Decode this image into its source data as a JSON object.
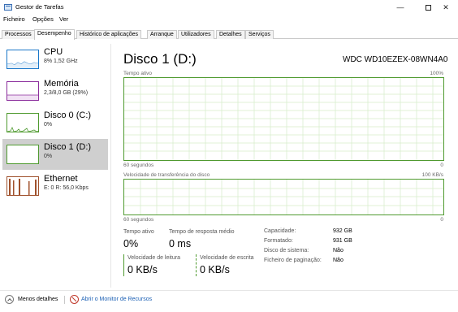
{
  "window": {
    "title": "Gestor de Tarefas",
    "controls": {
      "minimize": "—",
      "close": "✕"
    }
  },
  "menu": [
    "Ficheiro",
    "Opções",
    "Ver"
  ],
  "tabs": [
    "Processos",
    "Desempenho",
    "Histórico de aplicações",
    "Arranque",
    "Utilizadores",
    "Detalhes",
    "Serviços"
  ],
  "active_tab": "Desempenho",
  "resources": [
    {
      "name": "CPU",
      "sub": "8% 1,52 GHz",
      "color": "#1a77c9"
    },
    {
      "name": "Memória",
      "sub": "2,3/8,0 GB (29%)",
      "color": "#8b2d9c"
    },
    {
      "name": "Disco 0 (C:)",
      "sub": "0%",
      "color": "#4f9a2f"
    },
    {
      "name": "Disco 1 (D:)",
      "sub": "0%",
      "color": "#4f9a2f",
      "selected": true
    },
    {
      "name": "Ethernet",
      "sub": "E: 0 R: 56,0 Kbps",
      "color": "#a0522d"
    }
  ],
  "main": {
    "title": "Disco 1 (D:)",
    "model": "WDC WD10EZEX-08WN4A0",
    "graph1": {
      "label": "Tempo ativo",
      "max": "100%",
      "time": "60 segundos",
      "min": "0"
    },
    "graph2": {
      "label": "Velocidade de transferência do disco",
      "max": "100 KB/s",
      "time": "60 segundos",
      "min": "0"
    },
    "stats": {
      "active_time_label": "Tempo ativo",
      "active_time_value": "0%",
      "response_label": "Tempo de resposta médio",
      "response_value": "0 ms",
      "read_label": "Velocidade de leitura",
      "read_value": "0 KB/s",
      "write_label": "Velocidade de escrita",
      "write_value": "0 KB/s"
    },
    "properties": [
      {
        "key": "Capacidade:",
        "value": "932 GB"
      },
      {
        "key": "Formatado:",
        "value": "931 GB"
      },
      {
        "key": "Disco de sistema:",
        "value": "Não"
      },
      {
        "key": "Ficheiro de paginação:",
        "value": "Não"
      }
    ]
  },
  "footer": {
    "less_details": "Menos detalhes",
    "resource_monitor": "Abrir o Monitor de Recursos"
  }
}
